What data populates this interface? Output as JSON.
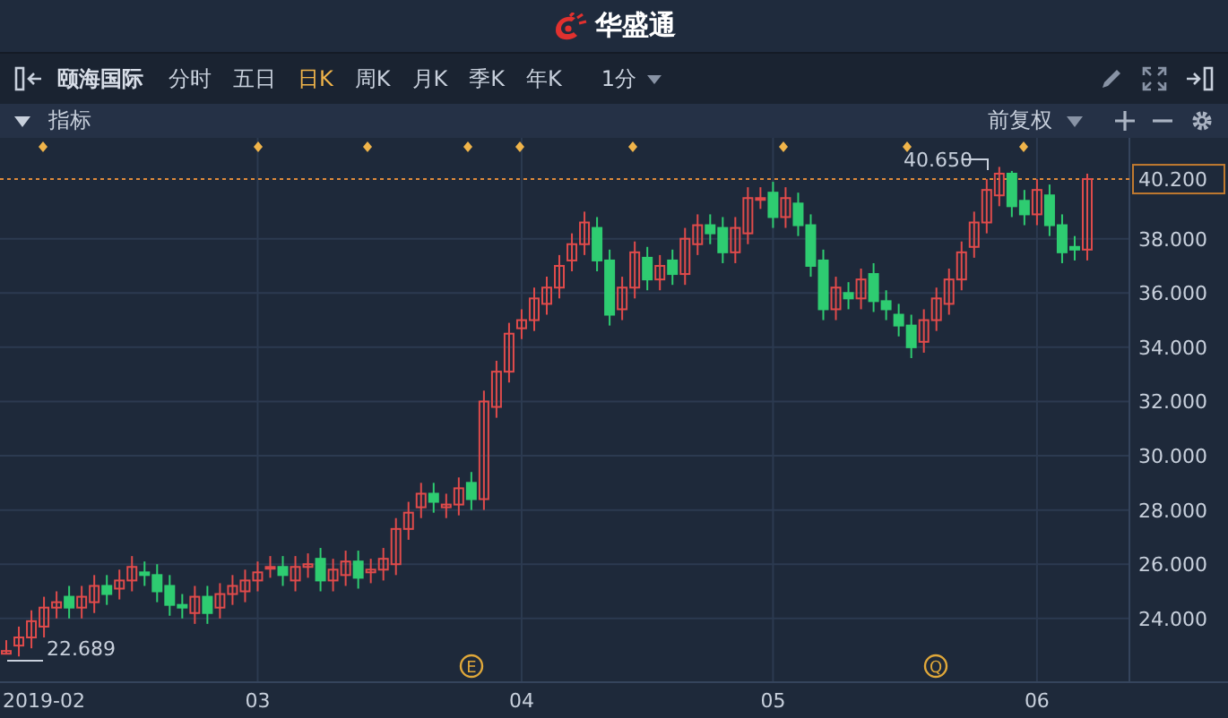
{
  "header": {
    "logo_text": "华盛通"
  },
  "toolbar": {
    "stock_name": "颐海国际",
    "periods": [
      {
        "label": "分时",
        "selected": false
      },
      {
        "label": "五日",
        "selected": false
      },
      {
        "label": "日K",
        "selected": true
      },
      {
        "label": "周K",
        "selected": false
      },
      {
        "label": "月K",
        "selected": false
      },
      {
        "label": "季K",
        "selected": false
      },
      {
        "label": "年K",
        "selected": false
      }
    ],
    "interval": "1分"
  },
  "indicator_bar": {
    "label": "指标",
    "adjustment": "前复权"
  },
  "chart": {
    "last_price": "40.200",
    "high_label": "40.650",
    "low_label": "22.689",
    "event_markers": [
      {
        "letter": "E"
      },
      {
        "letter": "Q"
      }
    ],
    "chart_data": {
      "type": "candlestick",
      "categories": [
        null,
        null,
        null,
        "2019-02",
        null,
        null,
        null,
        null,
        null,
        null,
        null,
        null,
        null,
        null,
        null,
        null,
        null,
        null,
        null,
        null,
        "03",
        null,
        null,
        null,
        null,
        null,
        null,
        null,
        null,
        null,
        null,
        null,
        null,
        null,
        null,
        null,
        null,
        null,
        null,
        null,
        null,
        "04",
        null,
        null,
        null,
        null,
        null,
        null,
        null,
        null,
        null,
        null,
        null,
        null,
        null,
        null,
        null,
        null,
        null,
        null,
        null,
        "05",
        null,
        null,
        null,
        null,
        null,
        null,
        null,
        null,
        null,
        null,
        null,
        null,
        null,
        null,
        null,
        null,
        null,
        null,
        null,
        null,
        "06",
        null,
        null,
        null,
        null
      ],
      "ylim": [
        21.65,
        41.72
      ],
      "grid": true,
      "ref_lines": [
        {
          "axis": "y",
          "value": 40.2
        }
      ],
      "ohlc": [
        [
          22.7,
          23.2,
          22.689,
          22.8
        ],
        [
          23.0,
          23.7,
          22.6,
          23.3
        ],
        [
          23.3,
          24.3,
          22.9,
          23.9
        ],
        [
          23.7,
          24.8,
          23.3,
          24.4
        ],
        [
          24.4,
          25.0,
          24.0,
          24.6
        ],
        [
          24.8,
          25.2,
          24.0,
          24.4
        ],
        [
          24.4,
          25.2,
          24.0,
          24.8
        ],
        [
          24.6,
          25.6,
          24.2,
          25.2
        ],
        [
          25.2,
          25.6,
          24.5,
          24.9
        ],
        [
          25.1,
          25.8,
          24.7,
          25.4
        ],
        [
          25.4,
          26.3,
          25.0,
          25.9
        ],
        [
          25.7,
          26.1,
          25.2,
          25.6
        ],
        [
          25.6,
          26.0,
          24.6,
          25.0
        ],
        [
          25.2,
          25.6,
          24.1,
          24.5
        ],
        [
          24.5,
          24.9,
          24.0,
          24.4
        ],
        [
          24.2,
          25.2,
          23.8,
          24.8
        ],
        [
          24.8,
          25.2,
          23.8,
          24.2
        ],
        [
          24.4,
          25.3,
          24.0,
          24.9
        ],
        [
          24.9,
          25.6,
          24.5,
          25.2
        ],
        [
          25.0,
          25.8,
          24.6,
          25.4
        ],
        [
          25.4,
          26.1,
          25.0,
          25.7
        ],
        [
          25.9,
          26.3,
          25.5,
          25.9
        ],
        [
          25.9,
          26.3,
          25.2,
          25.6
        ],
        [
          25.4,
          26.3,
          25.0,
          25.9
        ],
        [
          25.9,
          26.4,
          25.5,
          26.0
        ],
        [
          26.2,
          26.6,
          25.0,
          25.4
        ],
        [
          25.4,
          26.2,
          25.0,
          25.8
        ],
        [
          25.6,
          26.5,
          25.2,
          26.1
        ],
        [
          26.1,
          26.5,
          25.1,
          25.5
        ],
        [
          25.7,
          26.2,
          25.3,
          25.8
        ],
        [
          25.8,
          26.6,
          25.4,
          26.2
        ],
        [
          26.0,
          27.7,
          25.6,
          27.3
        ],
        [
          27.3,
          28.3,
          26.9,
          27.9
        ],
        [
          28.1,
          29.0,
          27.7,
          28.6
        ],
        [
          28.6,
          29.0,
          27.9,
          28.3
        ],
        [
          28.1,
          28.6,
          27.7,
          28.2
        ],
        [
          28.2,
          29.2,
          27.8,
          28.8
        ],
        [
          29.0,
          29.4,
          28.0,
          28.4
        ],
        [
          28.4,
          32.4,
          28.0,
          32.0
        ],
        [
          31.8,
          33.5,
          31.4,
          33.1
        ],
        [
          33.1,
          34.9,
          32.7,
          34.5
        ],
        [
          34.7,
          35.4,
          34.3,
          35.0
        ],
        [
          35.0,
          36.2,
          34.6,
          35.8
        ],
        [
          35.6,
          36.6,
          35.2,
          36.2
        ],
        [
          36.2,
          37.4,
          35.8,
          37.0
        ],
        [
          37.2,
          38.2,
          36.8,
          37.8
        ],
        [
          37.8,
          39.0,
          37.4,
          38.6
        ],
        [
          38.4,
          38.8,
          36.8,
          37.2
        ],
        [
          37.2,
          37.6,
          34.8,
          35.2
        ],
        [
          35.4,
          36.6,
          35.0,
          36.2
        ],
        [
          36.2,
          37.9,
          35.8,
          37.5
        ],
        [
          37.3,
          37.7,
          36.1,
          36.5
        ],
        [
          36.5,
          37.4,
          36.1,
          37.0
        ],
        [
          37.2,
          37.6,
          36.3,
          36.7
        ],
        [
          36.7,
          38.4,
          36.3,
          38.0
        ],
        [
          37.8,
          38.9,
          37.4,
          38.5
        ],
        [
          38.5,
          38.9,
          37.8,
          38.2
        ],
        [
          38.4,
          38.8,
          37.1,
          37.5
        ],
        [
          37.5,
          38.8,
          37.1,
          38.4
        ],
        [
          38.2,
          39.9,
          37.8,
          39.5
        ],
        [
          39.5,
          39.9,
          39.1,
          39.5
        ],
        [
          39.7,
          40.1,
          38.4,
          38.8
        ],
        [
          38.8,
          39.9,
          38.4,
          39.5
        ],
        [
          39.3,
          39.7,
          38.1,
          38.5
        ],
        [
          38.5,
          38.9,
          36.6,
          37.0
        ],
        [
          37.2,
          37.6,
          35.0,
          35.4
        ],
        [
          35.4,
          36.6,
          35.0,
          36.2
        ],
        [
          36.0,
          36.4,
          35.4,
          35.8
        ],
        [
          35.8,
          36.9,
          35.4,
          36.5
        ],
        [
          36.7,
          37.1,
          35.3,
          35.7
        ],
        [
          35.7,
          36.1,
          35.0,
          35.4
        ],
        [
          35.2,
          35.6,
          34.4,
          34.8
        ],
        [
          34.8,
          35.2,
          33.6,
          34.0
        ],
        [
          34.2,
          35.4,
          33.8,
          35.0
        ],
        [
          35.0,
          36.2,
          34.6,
          35.8
        ],
        [
          35.6,
          36.9,
          35.2,
          36.5
        ],
        [
          36.5,
          37.9,
          36.1,
          37.5
        ],
        [
          37.7,
          39.0,
          37.3,
          38.6
        ],
        [
          38.6,
          40.2,
          38.2,
          39.8
        ],
        [
          39.6,
          40.65,
          39.2,
          40.4
        ],
        [
          40.4,
          40.5,
          38.8,
          39.2
        ],
        [
          39.4,
          39.8,
          38.5,
          38.9
        ],
        [
          38.9,
          40.2,
          38.5,
          39.8
        ],
        [
          39.6,
          40.0,
          38.1,
          38.5
        ],
        [
          38.5,
          38.9,
          37.1,
          37.5
        ],
        [
          37.7,
          38.1,
          37.2,
          37.6
        ],
        [
          37.6,
          40.4,
          37.2,
          40.2
        ]
      ],
      "yticks": [
        {
          "value": 38,
          "label": "38.000"
        },
        {
          "value": 36,
          "label": "36.000"
        },
        {
          "value": 34,
          "label": "34.000"
        },
        {
          "value": 32,
          "label": "32.000"
        },
        {
          "value": 30,
          "label": "30.000"
        },
        {
          "value": 28,
          "label": "28.000"
        },
        {
          "value": 26,
          "label": "26.000"
        },
        {
          "value": 24,
          "label": "24.000"
        }
      ]
    }
  }
}
